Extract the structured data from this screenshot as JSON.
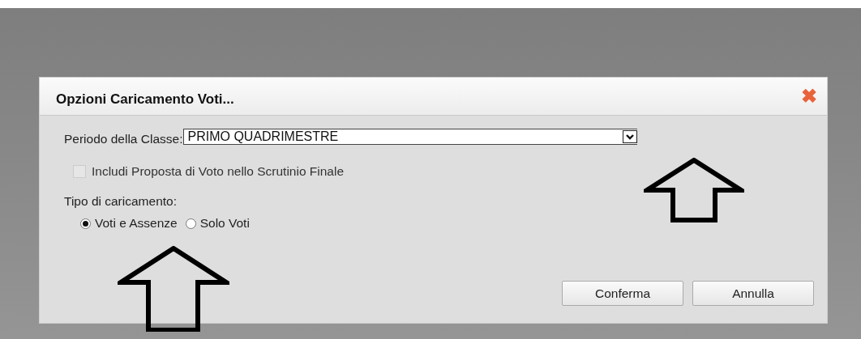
{
  "dialog": {
    "title": "Opzioni Caricamento Voti...",
    "close": "✖"
  },
  "period": {
    "label": "Periodo della Classe:",
    "value": "PRIMO QUADRIMESTRE"
  },
  "include_proposal": {
    "label": "Includi Proposta di Voto nello Scrutinio Finale",
    "checked": false,
    "disabled": true
  },
  "load_type": {
    "label": "Tipo di caricamento:",
    "options": [
      {
        "label": "Voti e Assenze",
        "selected": true
      },
      {
        "label": "Solo Voti",
        "selected": false
      }
    ]
  },
  "buttons": [
    "Conferma",
    "Annulla"
  ]
}
